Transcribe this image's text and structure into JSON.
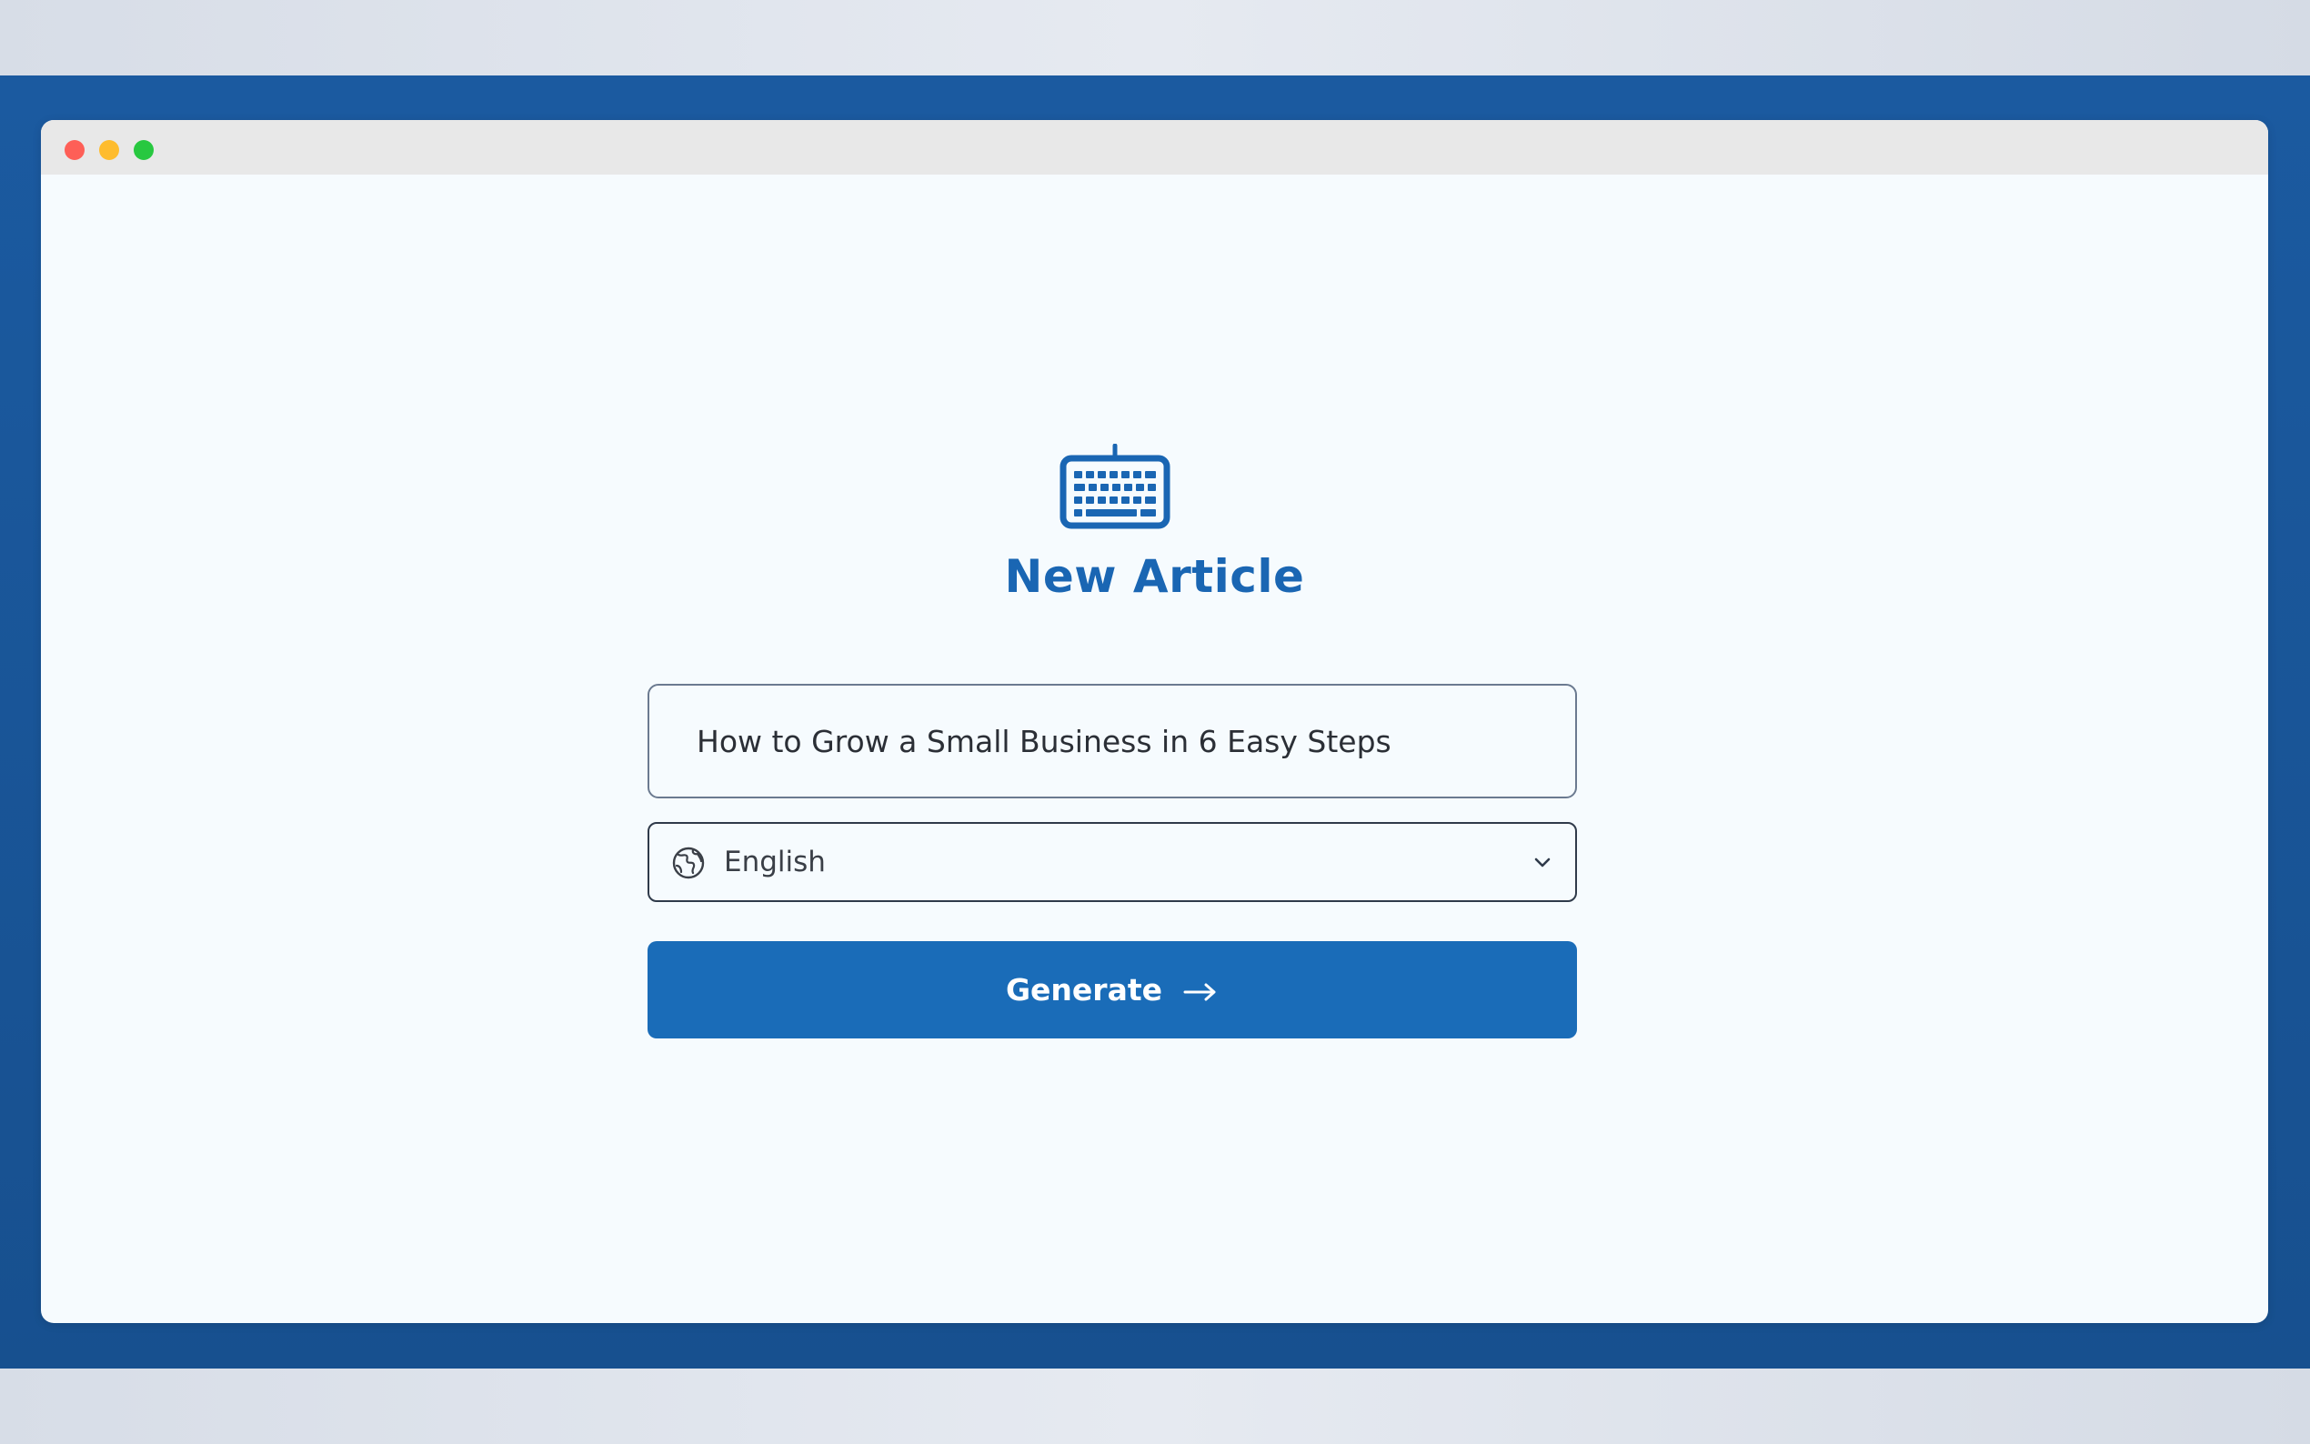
{
  "window": {
    "controls": {
      "close_color": "#fe5f57",
      "minimize_color": "#febc2e",
      "maximize_color": "#28c840"
    }
  },
  "header": {
    "icon": "keyboard-icon",
    "title": "New Article"
  },
  "form": {
    "topic_input": {
      "value": "How to Grow a Small Business in 6 Easy Steps"
    },
    "language_select": {
      "icon": "globe-icon",
      "selected": "English",
      "dropdown_icon": "chevron-down-icon"
    },
    "generate_button": {
      "label": "Generate",
      "icon": "arrow-right-icon"
    }
  },
  "colors": {
    "accent": "#1a6cb8",
    "title": "#1a66b3",
    "backdrop": "#1b5aa0",
    "canvas": "#f6fbfe"
  }
}
